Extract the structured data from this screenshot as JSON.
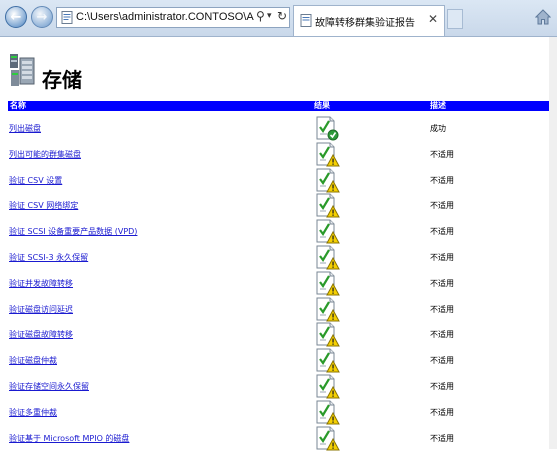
{
  "browser": {
    "address": "C:\\Users\\administrator.CONTOSO\\AppD",
    "tab_title": "故障转移群集验证报告",
    "back_icon": "back-arrow-icon",
    "forward_icon": "forward-arrow-icon"
  },
  "page": {
    "title": "存储"
  },
  "table": {
    "headers": {
      "name": "名称",
      "result": "结果",
      "description": "描述"
    },
    "rows": [
      {
        "name": "列出磁盘",
        "result_icon": "success-icon",
        "description": "成功"
      },
      {
        "name": "列出可能的群集磁盘",
        "result_icon": "warning-icon",
        "description": "不适用"
      },
      {
        "name": "验证 CSV 设置",
        "result_icon": "warning-icon",
        "description": "不适用"
      },
      {
        "name": "验证 CSV 网络绑定",
        "result_icon": "warning-icon",
        "description": "不适用"
      },
      {
        "name": "验证 SCSI 设备重要产品数据 (VPD)",
        "result_icon": "warning-icon",
        "description": "不适用"
      },
      {
        "name": "验证 SCSI-3 永久保留",
        "result_icon": "warning-icon",
        "description": "不适用"
      },
      {
        "name": "验证并发故障转移",
        "result_icon": "warning-icon",
        "description": "不适用"
      },
      {
        "name": "验证磁盘访问延迟",
        "result_icon": "warning-icon",
        "description": "不适用"
      },
      {
        "name": "验证磁盘故障转移",
        "result_icon": "warning-icon",
        "description": "不适用"
      },
      {
        "name": "验证磁盘仲裁",
        "result_icon": "warning-icon",
        "description": "不适用"
      },
      {
        "name": "验证存储空间永久保留",
        "result_icon": "warning-icon",
        "description": "不适用"
      },
      {
        "name": "验证多重仲裁",
        "result_icon": "warning-icon",
        "description": "不适用"
      },
      {
        "name": "验证基于 Microsoft MPIO 的磁盘",
        "result_icon": "warning-icon",
        "description": "不适用"
      }
    ]
  },
  "colors": {
    "header_bar": "#0000ff",
    "link": "#1a1ad0"
  }
}
